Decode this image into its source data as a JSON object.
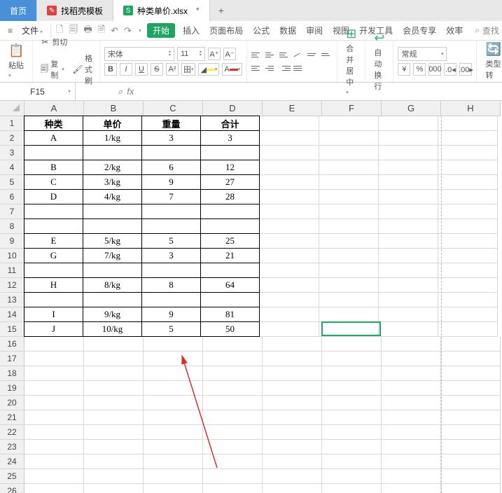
{
  "tabs": {
    "home": "首页",
    "doc1": "找稻壳模板",
    "doc2": "种类单价.xlsx",
    "dirty_marker": "*",
    "plus": "+"
  },
  "menu": {
    "file": "文件",
    "hamburger": "≡",
    "pill": "开始",
    "items": [
      "插入",
      "页面布局",
      "公式",
      "数据",
      "审阅",
      "视图",
      "开发工具",
      "会员专享",
      "效率"
    ],
    "search": "查找"
  },
  "ribbon": {
    "paste": "粘贴",
    "cut": "剪切",
    "copy": "复制",
    "fmtpaint": "格式刷",
    "font_name": "宋体",
    "font_size": "11",
    "bold": "B",
    "italic": "I",
    "uline": "U",
    "strike": "S",
    "mergecenter": "合并居中",
    "wrap": "自动换行",
    "numfmt": "常规",
    "typeconv": "类型转"
  },
  "namebox": "F15",
  "fx_label": "fx",
  "columns": [
    {
      "label": "A",
      "w": 85
    },
    {
      "label": "B",
      "w": 85
    },
    {
      "label": "C",
      "w": 85
    },
    {
      "label": "D",
      "w": 85
    },
    {
      "label": "E",
      "w": 85
    },
    {
      "label": "F",
      "w": 85
    },
    {
      "label": "G",
      "w": 85
    },
    {
      "label": "H",
      "w": 85
    }
  ],
  "row_count": 26,
  "table_range": {
    "r1": 1,
    "r2": 15,
    "c1": 0,
    "c2": 3
  },
  "selection": {
    "row": 15,
    "col": 5
  },
  "chart_data": {
    "type": "table",
    "headers": [
      "种类",
      "单价",
      "重量",
      "合计"
    ],
    "rows": [
      [
        "A",
        "1/kg",
        "3",
        "3"
      ],
      [
        "",
        "",
        "",
        ""
      ],
      [
        "B",
        "2/kg",
        "6",
        "12"
      ],
      [
        "C",
        "3/kg",
        "9",
        "27"
      ],
      [
        "D",
        "4/kg",
        "7",
        "28"
      ],
      [
        "",
        "",
        "",
        ""
      ],
      [
        "",
        "",
        "",
        ""
      ],
      [
        "E",
        "5/kg",
        "5",
        "25"
      ],
      [
        "G",
        "7/kg",
        "3",
        "21"
      ],
      [
        "",
        "",
        "",
        ""
      ],
      [
        "H",
        "8/kg",
        "8",
        "64"
      ],
      [
        "",
        "",
        "",
        ""
      ],
      [
        "I",
        "9/kg",
        "9",
        "81"
      ],
      [
        "J",
        "10/kg",
        "5",
        "50"
      ]
    ]
  }
}
